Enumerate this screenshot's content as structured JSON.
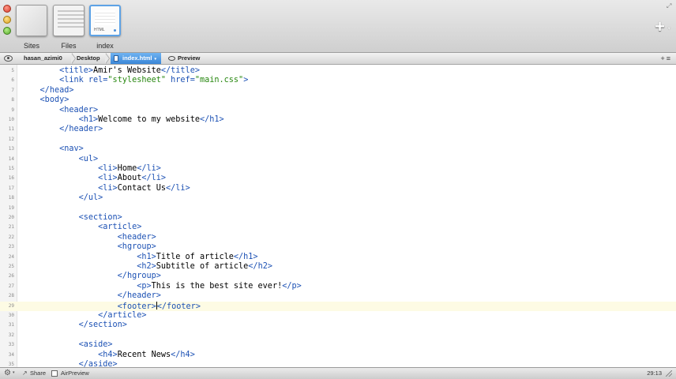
{
  "toolbar": {
    "tabs": [
      {
        "label": "Sites",
        "icon": "sites-thumbnail-icon"
      },
      {
        "label": "Files",
        "icon": "files-thumbnail-icon"
      },
      {
        "label": "index",
        "icon": "html-document-thumbnail-icon",
        "thumb_caption": "HTML",
        "selected": true
      }
    ],
    "add_button_label": "+",
    "add_button_caret": "▾"
  },
  "pathbar": {
    "crumbs": [
      "hasan_azimi0",
      "Desktop",
      "index.html"
    ],
    "active_caret": "▾",
    "preview_label": "Preview",
    "right_controls": "+≡"
  },
  "editor": {
    "current_line": 29,
    "lines": [
      {
        "n": "5",
        "code": "        <title>Amir's Website</title>"
      },
      {
        "n": "6",
        "code": "        <link rel=\"stylesheet\" href=\"main.css\">"
      },
      {
        "n": "7",
        "code": "    </head>"
      },
      {
        "n": "8",
        "code": "    <body>"
      },
      {
        "n": "9",
        "code": "        <header>"
      },
      {
        "n": "10",
        "code": "            <h1>Welcome to my website</h1>"
      },
      {
        "n": "11",
        "code": "        </header>"
      },
      {
        "n": "12",
        "code": ""
      },
      {
        "n": "13",
        "code": "        <nav>"
      },
      {
        "n": "14",
        "code": "            <ul>"
      },
      {
        "n": "15",
        "code": "                <li>Home</li>"
      },
      {
        "n": "16",
        "code": "                <li>About</li>"
      },
      {
        "n": "17",
        "code": "                <li>Contact Us</li>"
      },
      {
        "n": "18",
        "code": "            </ul>"
      },
      {
        "n": "19",
        "code": ""
      },
      {
        "n": "20",
        "code": "            <section>"
      },
      {
        "n": "21",
        "code": "                <article>"
      },
      {
        "n": "22",
        "code": "                    <header>"
      },
      {
        "n": "23",
        "code": "                    <hgroup>"
      },
      {
        "n": "24",
        "code": "                        <h1>Title of article</h1>"
      },
      {
        "n": "25",
        "code": "                        <h2>Subtitle of article</h2>"
      },
      {
        "n": "26",
        "code": "                    </hgroup>"
      },
      {
        "n": "27",
        "code": "                        <p>This is the best site ever!</p>"
      },
      {
        "n": "28",
        "code": "                    </header>"
      },
      {
        "n": "29",
        "code": "                    <footer></footer>",
        "cursor_after": 28
      },
      {
        "n": "30",
        "code": "                </article>"
      },
      {
        "n": "31",
        "code": "            </section>"
      },
      {
        "n": "32",
        "code": ""
      },
      {
        "n": "33",
        "code": "            <aside>"
      },
      {
        "n": "34",
        "code": "                <h4>Recent News</h4>"
      },
      {
        "n": "35",
        "code": "            </aside>"
      }
    ]
  },
  "statusbar": {
    "settings_icon": "gear-icon",
    "share_label": "Share",
    "airpreview_label": "AirPreview",
    "cursor_position": "29:13"
  },
  "colors": {
    "tag": "#1c51b4",
    "string": "#27870f",
    "selection_blue": "#3a86d7"
  }
}
